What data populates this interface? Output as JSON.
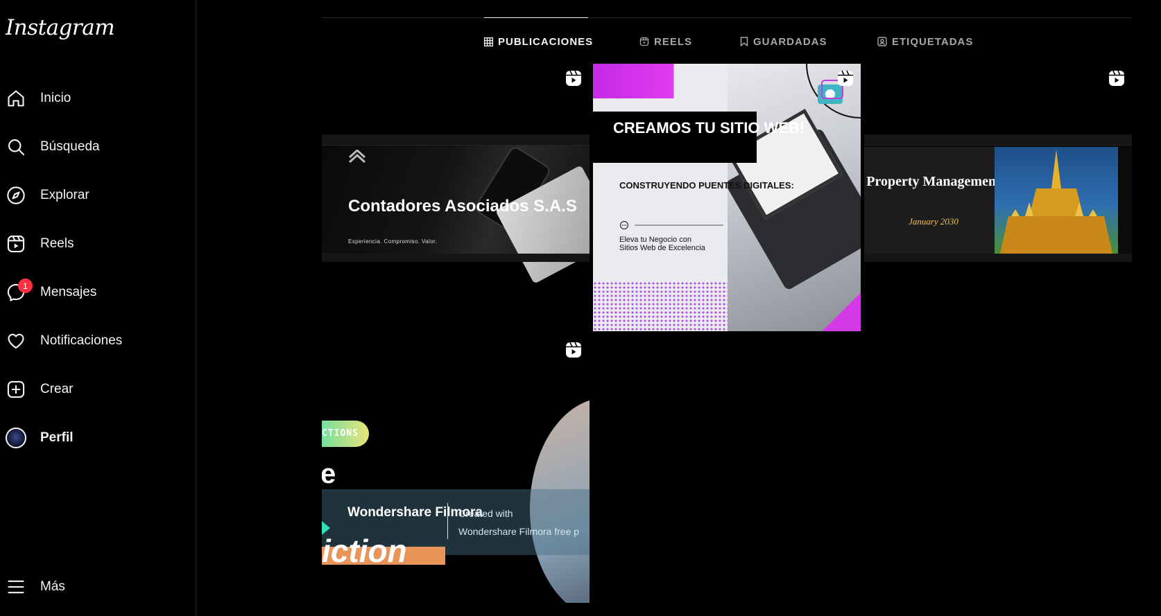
{
  "app": {
    "logo": "Instagram"
  },
  "sidebar": {
    "items": [
      {
        "label": "Inicio",
        "icon": "home-icon"
      },
      {
        "label": "Búsqueda",
        "icon": "search-icon"
      },
      {
        "label": "Explorar",
        "icon": "compass-icon"
      },
      {
        "label": "Reels",
        "icon": "reels-icon"
      },
      {
        "label": "Mensajes",
        "icon": "messenger-icon",
        "badge": "1"
      },
      {
        "label": "Notificaciones",
        "icon": "heart-icon"
      },
      {
        "label": "Crear",
        "icon": "plus-square-icon"
      },
      {
        "label": "Perfil",
        "icon": "avatar"
      }
    ],
    "more": {
      "label": "Más",
      "icon": "menu-icon"
    },
    "badge_color": "#ff3040"
  },
  "tabs": [
    {
      "label": "PUBLICACIONES",
      "icon": "grid-icon",
      "active": true
    },
    {
      "label": "REELS",
      "icon": "reels-icon",
      "active": false
    },
    {
      "label": "GUARDADAS",
      "icon": "bookmark-icon",
      "active": false
    },
    {
      "label": "ETIQUETADAS",
      "icon": "tag-user-icon",
      "active": false
    }
  ],
  "posts": [
    {
      "type": "reel",
      "title": "Contadores Asociados S.A.S",
      "subtitle": "Experiencia. Compromiso. Valor."
    },
    {
      "type": "reel",
      "title": "CREAMOS TU SITIO WEB!",
      "subtitle": "CONSTRUYENDO PUENTES DIGITALES:",
      "body": "Eleva tu Negocio con Sitios Web de Excelencia"
    },
    {
      "type": "reel",
      "title": "Property Management",
      "subtitle": "January 2030"
    },
    {
      "type": "reel",
      "pill": "CTIONS",
      "fragment": "e",
      "brand": "Wondershare Filmora",
      "created": "Created with",
      "created_line2": "Wondershare Filmora free p",
      "fragment2": "iction"
    }
  ],
  "colors": {
    "accent_pink": "#e23bf0",
    "accent_purple": "#8a2be2",
    "gold": "#f2c14e"
  }
}
